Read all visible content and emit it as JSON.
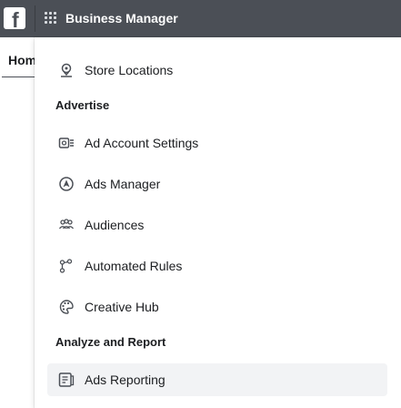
{
  "topbar": {
    "logo_letter": "f",
    "title": "Business Manager"
  },
  "page": {
    "home_tab": "Home"
  },
  "menu": {
    "store_locations": "Store Locations",
    "section_advertise": "Advertise",
    "ad_account_settings": "Ad Account Settings",
    "ads_manager": "Ads Manager",
    "audiences": "Audiences",
    "automated_rules": "Automated Rules",
    "creative_hub": "Creative Hub",
    "section_analyze": "Analyze and Report",
    "ads_reporting": "Ads Reporting"
  },
  "icons": {
    "store_locations": "map-pin-icon",
    "ad_account_settings": "ad-account-settings-icon",
    "ads_manager": "ads-manager-icon",
    "audiences": "audiences-icon",
    "automated_rules": "automated-rules-icon",
    "creative_hub": "palette-icon",
    "ads_reporting": "report-icon"
  },
  "colors": {
    "topbar_bg": "#4b4f56",
    "active_item_bg": "#f2f3f5"
  }
}
